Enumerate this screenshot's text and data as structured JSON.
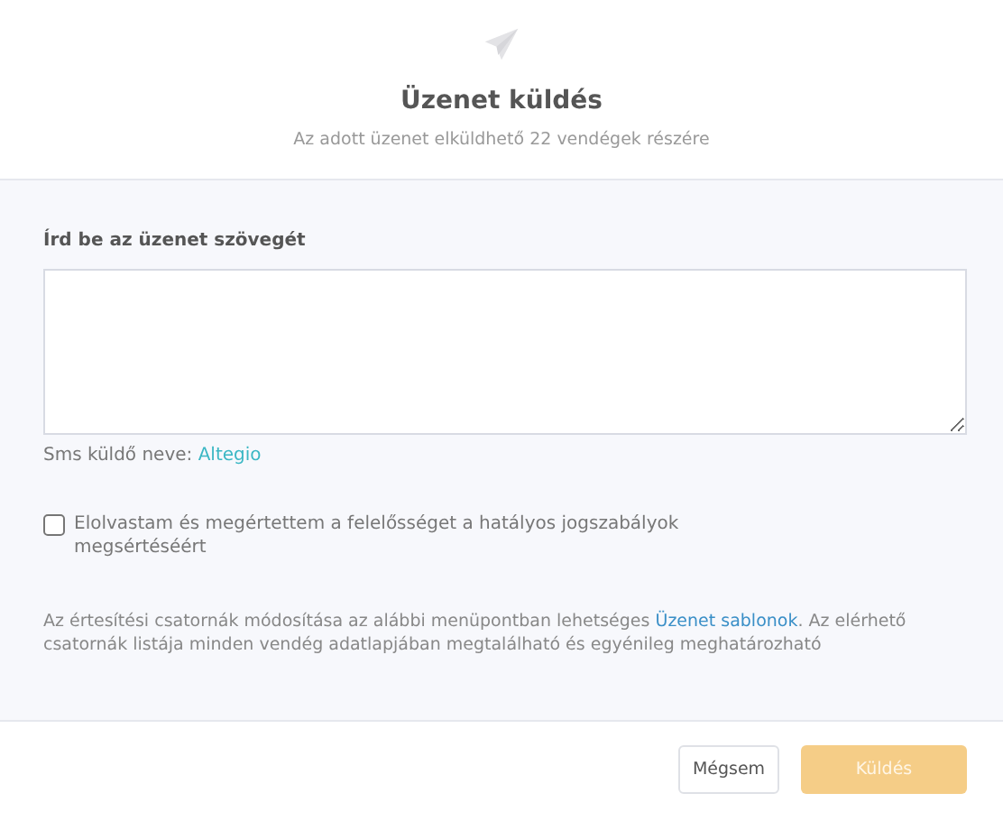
{
  "dialog": {
    "title": "Üzenet küldés",
    "subtitle": "Az adott üzenet elküldhető 22 vendégek részére"
  },
  "message": {
    "label": "Írd be az üzenet szövegét"
  },
  "sender": {
    "label": "Sms küldő neve:",
    "name": "Altegio"
  },
  "consent": {
    "label": "Elolvastam és megértettem a felelősséget a hatályos jogszabályok megsértéséért",
    "checked": false
  },
  "notice": {
    "before": "Az értesítési csatornák módosítása az alábbi menüpontban lehetséges ",
    "link": "Üzenet sablonok",
    "after": ". Az elérhető csatornák listája minden vendég adatlapjában megtalálható és egyénileg meghatározható"
  },
  "buttons": [
    {
      "label": "Mégsem",
      "kind": "secondary",
      "disabled": false
    },
    {
      "label": "Küldés",
      "kind": "primary",
      "disabled": true
    }
  ]
}
